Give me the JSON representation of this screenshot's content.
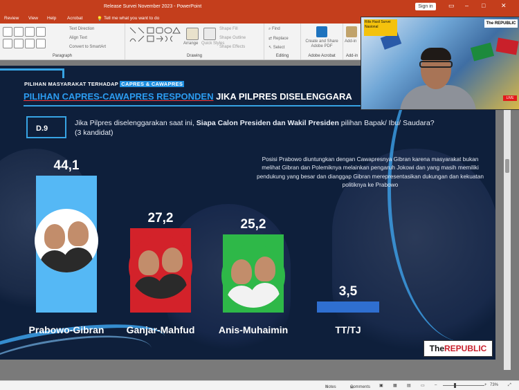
{
  "window": {
    "title": "Release Survei November 2023  -  PowerPoint",
    "signin_label": "Sign in"
  },
  "menu": {
    "tabs": [
      "Review",
      "View",
      "Help",
      "Acrobat"
    ],
    "tell_me": "Tell me what you want to do"
  },
  "ribbon": {
    "paragraph_items": [
      "Text Direction",
      "Align Text",
      "Convert to SmartArt"
    ],
    "paragraph_label": "Paragraph",
    "drawing_items": [
      "Arrange",
      "Quick Styles",
      "Shape Fill",
      "Shape Outline",
      "Shape Effects"
    ],
    "drawing_label": "Drawing",
    "editing_items": [
      "Find",
      "Replace",
      "Select"
    ],
    "editing_label": "Editing",
    "acrobat_button": "Create and Share Adobe PDF",
    "acrobat_label": "Adobe Acrobat",
    "addin_label": "Add-in",
    "addin_button": "Add-in"
  },
  "slide": {
    "header_small_prefix": "PILIHAN MASYARAKAT TERHADAP",
    "header_small_highlight": "CAPRES & CAWAPRES",
    "header_blue": "PILIHAN CAPRES-CAWAPRES  RESPONDEN",
    "header_white": "JIKA PILPRES DISELENGGARA",
    "question_code": "D.9",
    "question_text_1": "Jika Pilpres diselenggarakan saat ini, ",
    "question_text_bold": "Siapa Calon Presiden dan Wakil Presiden",
    "question_text_2": " pilihan Bapak/ Ibu/ Saudara? (3 kandidat)",
    "note": "Posisi Prabowo diuntungkan dengan Cawapresnya Gibran karena masyarakat bukan melihat Gibran dan Polemiknya melainkan pengaruh Jokowi dan yang masih memiliki pendukung yang besar dan dianggap Gibran merepresentasikan dukungan dan kekuatan politiknya ke Prabowo",
    "logo_prefix": "The",
    "logo_name": "REPUBLIC"
  },
  "chart_data": {
    "type": "bar",
    "categories": [
      "Prabowo-Gibran",
      "Ganjar-Mahfud",
      "Anis-Muhaimin",
      "TT/TJ"
    ],
    "values": [
      44.1,
      27.2,
      25.2,
      3.5
    ],
    "value_labels": [
      "44,1",
      "27,2",
      "25,2",
      "3,5"
    ],
    "colors": [
      "#55b8f5",
      "#d3222a",
      "#2eb848",
      "#2f6fd0"
    ],
    "ylim": [
      0,
      44.1
    ]
  },
  "video": {
    "logo": "The REPUBLIC",
    "tag": "Rilis Hasil Survei Nasional",
    "live": "LIVE"
  },
  "status": {
    "notes_label": "Notes",
    "comments_label": "Comments",
    "zoom": "73%"
  }
}
